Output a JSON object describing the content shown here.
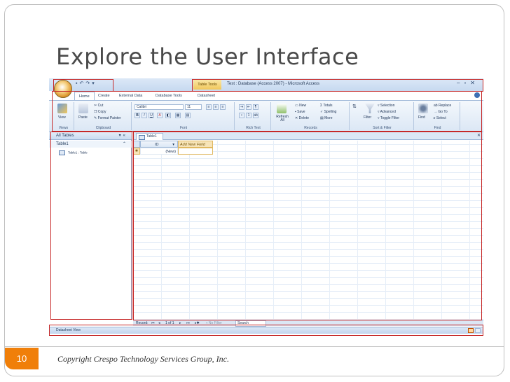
{
  "slide": {
    "title": "Explore the User Interface",
    "page_number": "10",
    "copyright": "Copyright Crespo Technology Services Group, Inc."
  },
  "colors": {
    "accent": "#f07f09",
    "annotation_border": "#c62828",
    "ribbon": "#dbe7f5"
  },
  "app": {
    "title": "Test : Database (Access 2007) - Microsoft Access",
    "contextual_tab": "Table Tools",
    "qat_icons": [
      "save-icon",
      "undo-icon",
      "redo-icon",
      "customize-icon"
    ],
    "window_controls": [
      "minimize-icon",
      "restore-icon",
      "close-icon"
    ],
    "tabs": [
      "Home",
      "Create",
      "External Data",
      "Database Tools",
      "Datasheet"
    ],
    "ribbon": {
      "views": {
        "label": "Views",
        "view": "View"
      },
      "clipboard": {
        "label": "Clipboard",
        "paste": "Paste",
        "cut": "Cut",
        "copy": "Copy",
        "format_painter": "Format Painter"
      },
      "font": {
        "label": "Font",
        "font_name": "Calibri",
        "font_size": "11"
      },
      "rich_text": {
        "label": "Rich Text"
      },
      "records": {
        "label": "Records",
        "refresh": "Refresh All",
        "new": "New",
        "save": "Save",
        "delete": "Delete",
        "totals": "Totals",
        "spelling": "Spelling",
        "more": "More"
      },
      "sort_filter": {
        "label": "Sort & Filter",
        "filter": "Filter",
        "selection": "Selection",
        "advanced": "Advanced",
        "toggle_filter": "Toggle Filter"
      },
      "find": {
        "label": "Find",
        "find": "Find",
        "replace": "Replace",
        "go_to": "Go To",
        "select": "Select"
      }
    },
    "nav_pane": {
      "header": "All Tables",
      "group": "Table1",
      "item": "Table1 : Table"
    },
    "document": {
      "tab": "Table1",
      "columns": [
        "ID",
        "Add New Field"
      ],
      "new_row_label": "(New)"
    },
    "record_nav": {
      "label": "Record:",
      "position": "1 of 1",
      "filter": "No Filter",
      "search": "Search"
    },
    "status": {
      "left": "Datasheet View"
    }
  }
}
